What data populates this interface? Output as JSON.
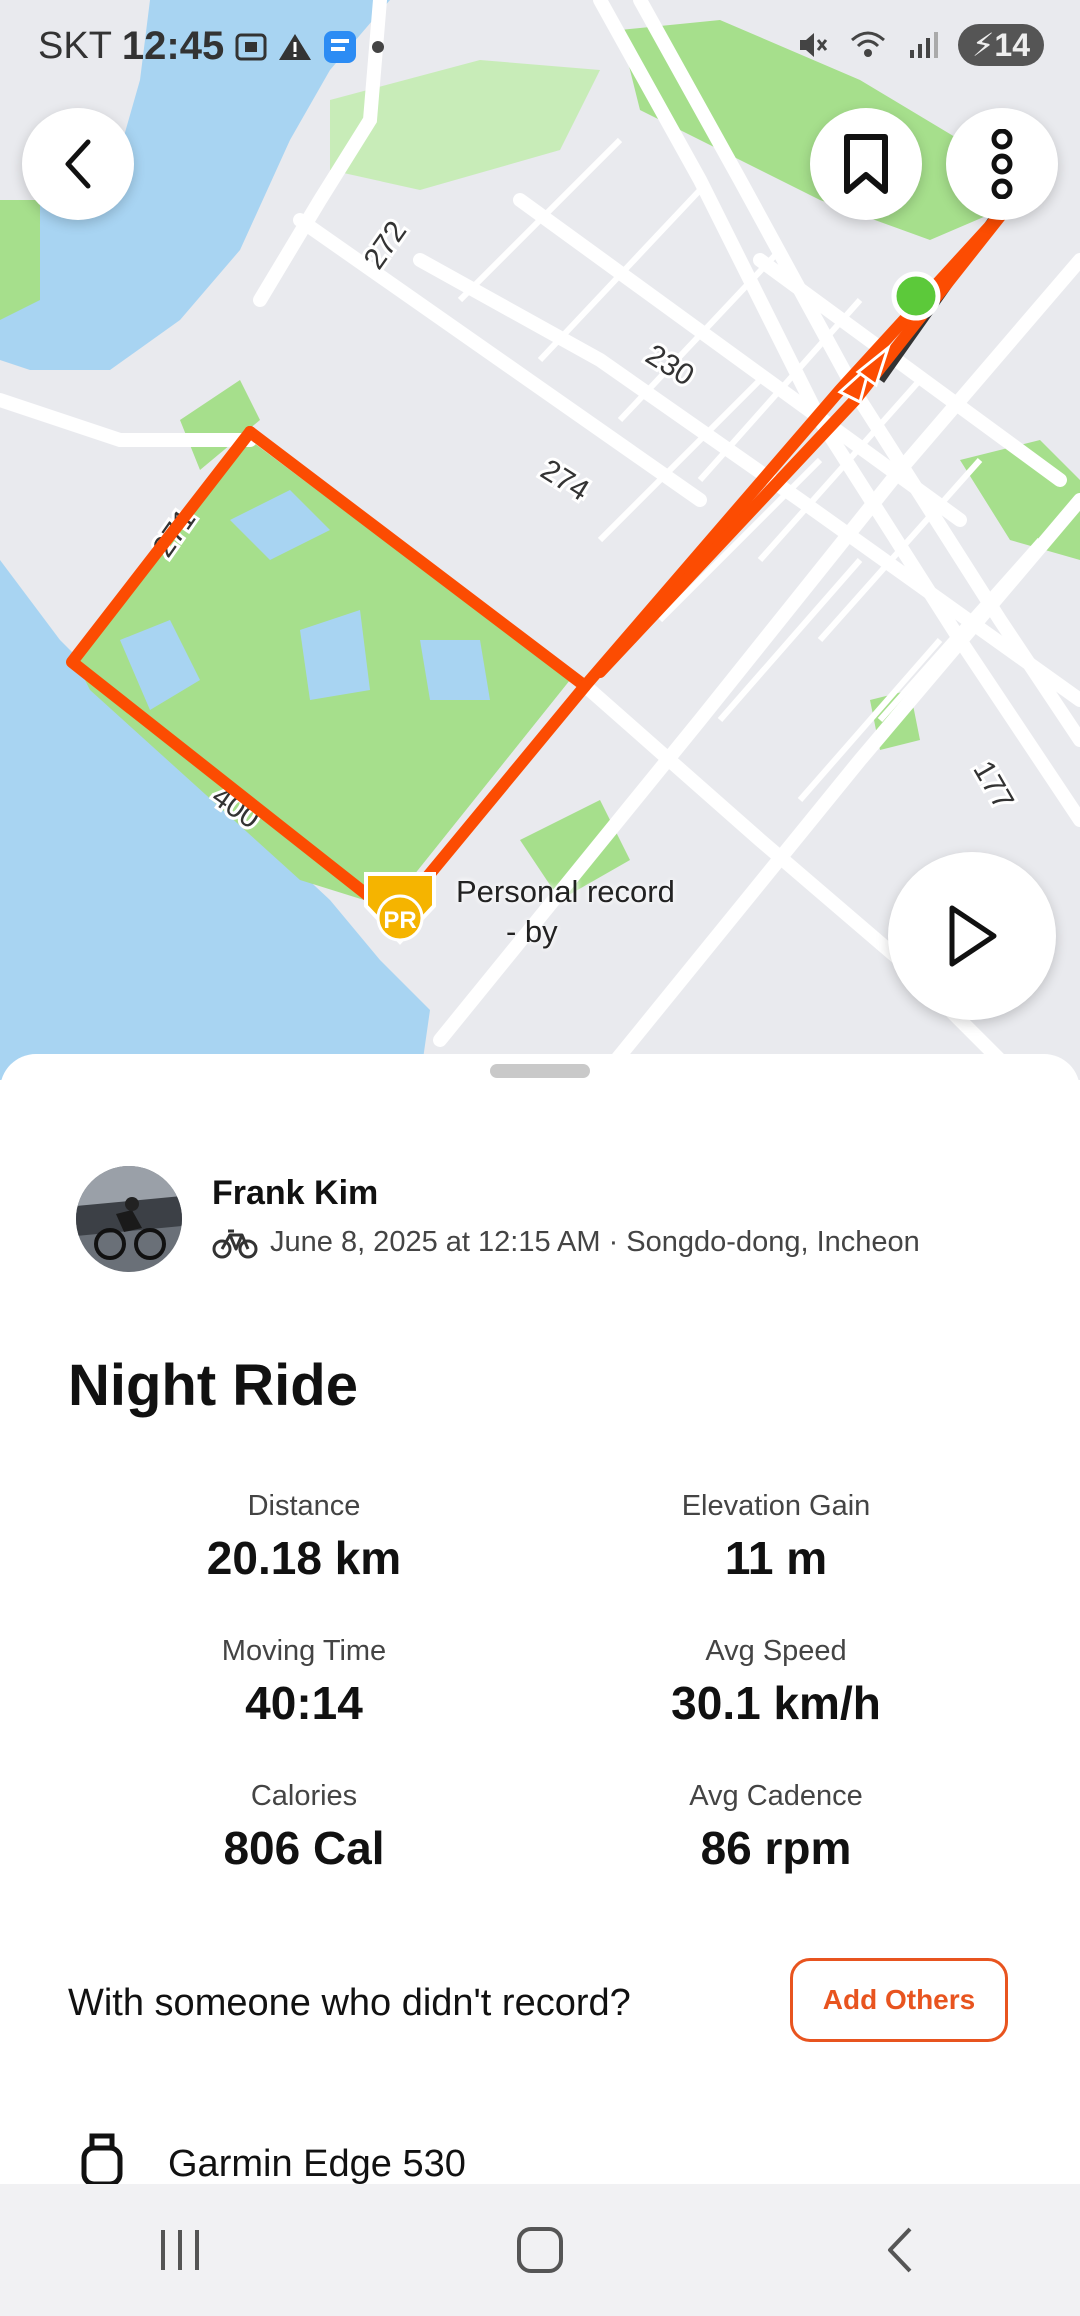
{
  "status_bar": {
    "carrier": "SKT",
    "time": "12:45",
    "battery": "14",
    "icons": [
      "screenshot-icon",
      "warning-icon",
      "app-icon",
      "dot-icon",
      "mute-icon",
      "wifi-icon",
      "signal-icon",
      "battery-icon"
    ]
  },
  "map": {
    "road_labels": [
      "272",
      "230",
      "274",
      "271",
      "400",
      "177"
    ],
    "pr_badge": "PR",
    "pr_label_line1": "Personal record",
    "pr_label_line2": "-    by",
    "colors": {
      "route": "#fc4c02",
      "water": "#a8d4f2",
      "park": "#a6df8c",
      "land": "#e9eaee",
      "start": "#5cc93a"
    }
  },
  "buttons": {
    "back": "back-icon",
    "bookmark": "bookmark-icon",
    "more": "more-icon",
    "play": "play-icon"
  },
  "activity": {
    "athlete": "Frank Kim",
    "meta": "June 8, 2025 at 12:15 AM · Songdo-dong, Incheon",
    "sport_icon": "bike-icon",
    "title": "Night Ride",
    "stats": [
      {
        "label": "Distance",
        "value": "20.18 km"
      },
      {
        "label": "Elevation Gain",
        "value": "11 m"
      },
      {
        "label": "Moving Time",
        "value": "40:14"
      },
      {
        "label": "Avg Speed",
        "value": "30.1 km/h"
      },
      {
        "label": "Calories",
        "value": "806 Cal"
      },
      {
        "label": "Avg Cadence",
        "value": "86 rpm"
      }
    ],
    "companion_prompt": "With someone who didn't record?",
    "add_others": "Add Others",
    "device": "Garmin Edge 530"
  },
  "navbar": {
    "recents": "recents-icon",
    "home": "home-icon",
    "back": "nav-back-icon"
  }
}
